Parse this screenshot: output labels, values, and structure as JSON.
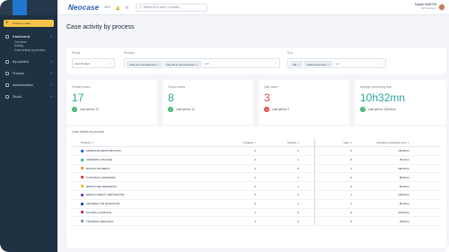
{
  "sidebar": {
    "create_label": "Create a case",
    "items": [
      {
        "label": "Dashboards",
        "subitems": [
          "Overview",
          "Activity",
          "Case activity by process"
        ]
      },
      {
        "label": "My worklist"
      },
      {
        "label": "Process"
      },
      {
        "label": "Administration"
      },
      {
        "label": "Studio"
      }
    ]
  },
  "topbar": {
    "brand": "Neocase",
    "selector": "All ▾",
    "search_placeholder": "Search for a case, a contact...",
    "user_name": "Sophie MARTIN",
    "user_role": "HR Manager"
  },
  "page": {
    "title": "Case activity by process"
  },
  "filters": {
    "period": {
      "label": "Period",
      "value": "Last 30 days"
    },
    "process": {
      "label": "Process",
      "chips": [
        "Absence management",
        "Payroll & compensation"
      ],
      "more": "+10"
    },
    "sla": {
      "label": "SLA",
      "chips": [
        "HR",
        "Shared services"
      ],
      "more": "+2"
    }
  },
  "kpis": [
    {
      "label": "Created cases",
      "value": "17",
      "color": "#2aa59a",
      "growth": "Last period: 12"
    },
    {
      "label": "Closed cases",
      "value": "8",
      "color": "#2aa59a",
      "growth": "Last period: 11"
    },
    {
      "label": "Late cases",
      "value": "3",
      "color": "#e5484d",
      "growth": "Last period: 2"
    },
    {
      "label": "Average processing time",
      "value": "10h32mn",
      "color": "#2aa59a",
      "growth": "Last period: 12h14mn"
    }
  ],
  "table": {
    "title": "Case details by process",
    "headers": [
      "Process",
      "Created",
      "Closed",
      "Late",
      "Average processing time"
    ],
    "rows": [
      {
        "color": "#1e6fd9",
        "name": "ABSENCE REGISTRATION",
        "created": "4",
        "closed": "2",
        "late": "0",
        "avg": "12h45mn"
      },
      {
        "color": "#3fb6a8",
        "name": "ADDRESS CHANGE",
        "created": "1",
        "closed": "1",
        "late": "0",
        "avg": "3h12mn"
      },
      {
        "color": "#e2a12b",
        "name": "BONUS PAYMENT",
        "created": "2",
        "closed": "0",
        "late": "1",
        "avg": "26h30mn"
      },
      {
        "color": "#e5484d",
        "name": "CONTRACT RENEWAL",
        "created": "1",
        "closed": "1",
        "late": "0",
        "avg": "8h05mn"
      },
      {
        "color": "#e2c12b",
        "name": "EMPLOYEE REFERRAL",
        "created": "2",
        "closed": "1",
        "late": "0",
        "avg": "6h40mn"
      },
      {
        "color": "#7b3fb6",
        "name": "EMPLOYMENT CERTIFICATE",
        "created": "3",
        "closed": "2",
        "late": "1",
        "avg": "14h22mn"
      },
      {
        "color": "#1f4aa8",
        "name": "GENERAL HR QUESTION",
        "created": "2",
        "closed": "1",
        "late": "1",
        "avg": "9h18mn"
      },
      {
        "color": "#c23a7a",
        "name": "PAYROLL DISPUTE",
        "created": "1",
        "closed": "0",
        "late": "0",
        "avg": "11h00mn"
      },
      {
        "color": "#8a98a8",
        "name": "TRAINING REQUEST",
        "created": "1",
        "closed": "0",
        "late": "0",
        "avg": "2h55mn"
      }
    ]
  }
}
